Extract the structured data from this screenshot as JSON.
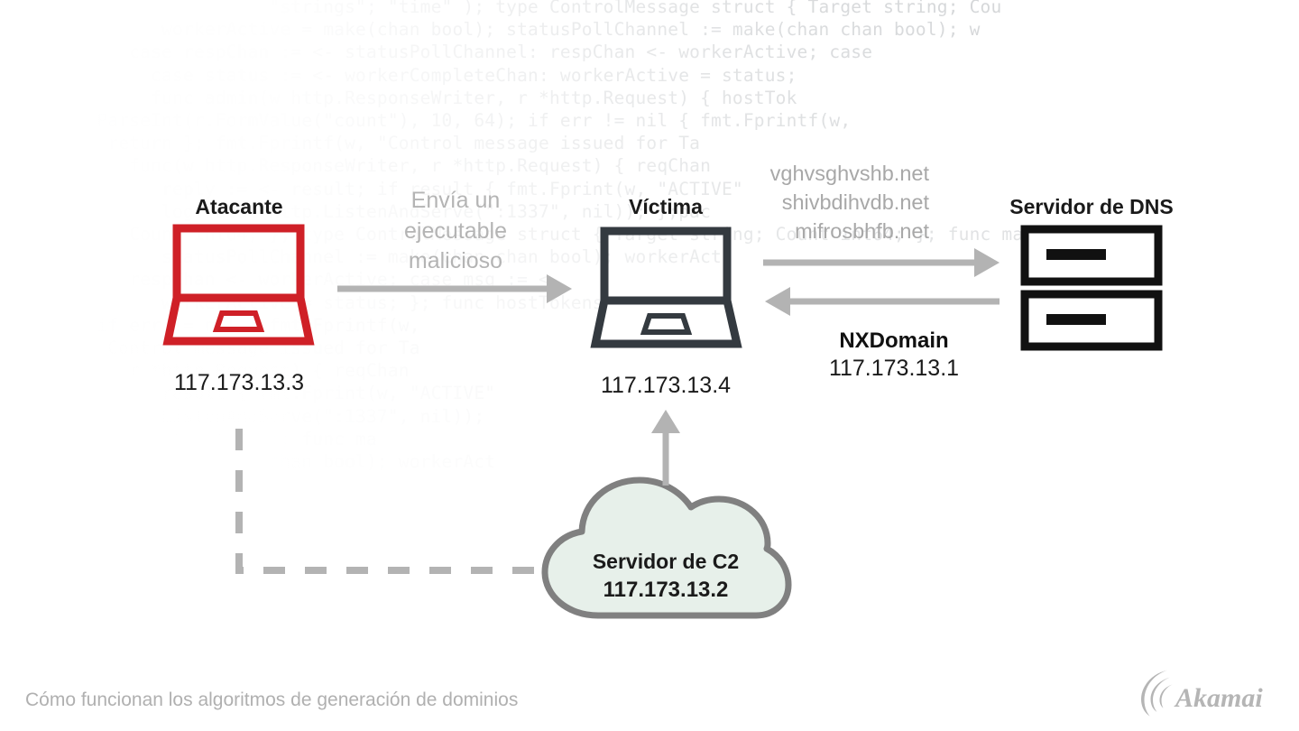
{
  "diagram": {
    "caption": "Cómo funcionan los algoritmos de generación de dominios",
    "brand": "Akamai",
    "colors": {
      "attacker": "#cf2027",
      "victim": "#343a40",
      "dns_server": "#111111",
      "arrow": "#b3b3b3",
      "dashed": "#b3b3b3",
      "cloud_fill": "#e7f0ea",
      "cloud_stroke": "#808080",
      "code_text": "#d4d6d8",
      "muted_text": "#b0b0b0"
    },
    "nodes": {
      "attacker": {
        "title": "Atacante",
        "ip": "117.173.13.3",
        "icon": "laptop-icon"
      },
      "victim": {
        "title": "Víctima",
        "ip": "117.173.13.4",
        "icon": "laptop-icon"
      },
      "dns_server": {
        "title": "Servidor de DNS",
        "icon": "server-rack-icon"
      },
      "c2_server": {
        "title": "Servidor de C2",
        "ip": "117.173.13.2",
        "icon": "cloud-icon"
      }
    },
    "flows": {
      "attacker_to_victim": "Envía un\nejecutable\nmalicioso",
      "victim_to_dns_queries": "vghvsghvshb.net\nshivbdihvdb.net\nmifrosbhfb.net",
      "dns_to_victim_response": "NXDomain",
      "dns_to_victim_ip": "117.173.13.1"
    },
    "background_code": [
      "                         \"strings\"; \"time\" ); type ControlMessage struct { Target string; Cou",
      "               workerActive = make(chan bool); statusPollChannel := make(chan chan bool); w",
      "            case respChan := <- statusPollChannel: respChan <- workerActive; case",
      "              case status := <- workerCompleteChan: workerActive = status;",
      "              func admin(w http.ResponseWriter, r *http.Request) { hostTok",
      "         ParseInt(r.FormValue(\"count\"), 10, 64); if err != nil { fmt.Fprintf(w,",
      "          return }; fmt.Fprintf(w, \"Control message issued for Ta",
      "            func(w http.ResponseWriter, r *http.Request) { reqChan",
      "               reply := <- result; if result { fmt.Fprint(w, \"ACTIVE\"",
      "               log.Fatal(http.ListenAndServe(\":1337\", nil)); };pac",
      "            Count int64; }; type ControlMessage struct { Target string; Count int64; }; func mai",
      "               statusPollChannel := make(chan chan bool); workerActi",
      "            respChan <- workerActive; case msg := <-",
      "               workerActive = status; }; func hostTokens",
      "         if err != nil { fmt.Fprintf(w,",
      "          Control message issued for Ta",
      "            r *http.Request) { reqChan",
      "               result { fmt.Fprint(w, \"ACTIVE\"",
      "               ListenAndServe(\":1337\", nil));",
      "            Count int64; }; func ma",
      "               make(chan chan bool); workerAct"
    ]
  }
}
